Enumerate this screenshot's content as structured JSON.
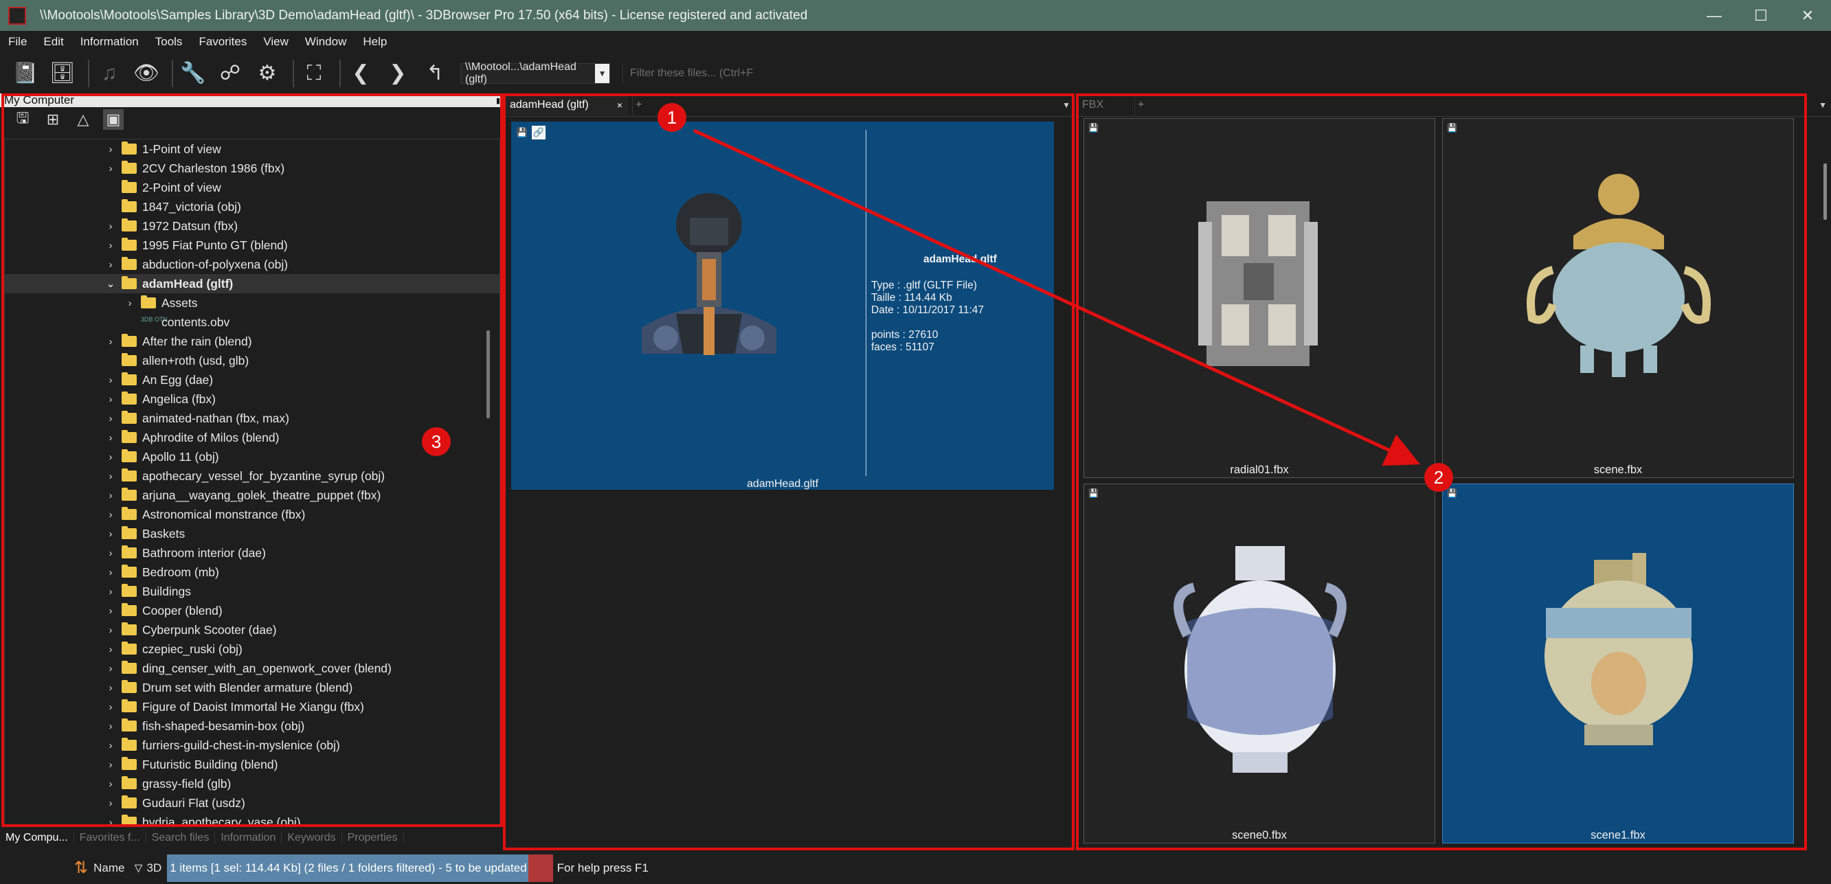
{
  "window": {
    "title": "\\\\Mootools\\Mootools\\Samples Library\\3D Demo\\adamHead (gltf)\\ - 3DBrowser Pro 17.50 (x64 bits) - License registered  and activated",
    "minimize": "—",
    "maximize": "☐",
    "close": "✕"
  },
  "menu": [
    "File",
    "Edit",
    "Information",
    "Tools",
    "Favorites",
    "View",
    "Window",
    "Help"
  ],
  "toolbar": {
    "path": "\\\\Mootool...\\adamHead (gltf)",
    "filter_placeholder": "Filter these files... (Ctrl+F"
  },
  "left_panel": {
    "header": "My Computer",
    "tree": [
      {
        "label": "1-Point of view",
        "chevron": true,
        "type": "folder",
        "indent": 0
      },
      {
        "label": "2CV Charleston 1986 (fbx)",
        "chevron": true,
        "type": "folder",
        "indent": 0
      },
      {
        "label": "2-Point of view",
        "chevron": false,
        "type": "folder",
        "indent": 0
      },
      {
        "label": "1847_victoria (obj)",
        "chevron": false,
        "type": "folder",
        "indent": 0
      },
      {
        "label": "1972 Datsun (fbx)",
        "chevron": true,
        "type": "folder",
        "indent": 0
      },
      {
        "label": "1995 Fiat Punto GT (blend)",
        "chevron": true,
        "type": "folder",
        "indent": 0
      },
      {
        "label": "abduction-of-polyxena (obj)",
        "chevron": true,
        "type": "folder",
        "indent": 0
      },
      {
        "label": "adamHead (gltf)",
        "chevron": "open",
        "type": "folder",
        "indent": 0,
        "selected": true
      },
      {
        "label": "Assets",
        "chevron": true,
        "type": "folder",
        "indent": 1
      },
      {
        "label": "contents.obv",
        "chevron": false,
        "type": "file",
        "indent": 1
      },
      {
        "label": "After the rain (blend)",
        "chevron": true,
        "type": "folder",
        "indent": 0
      },
      {
        "label": "allen+roth (usd, glb)",
        "chevron": false,
        "type": "folder",
        "indent": 0
      },
      {
        "label": "An Egg (dae)",
        "chevron": true,
        "type": "folder",
        "indent": 0
      },
      {
        "label": "Angelica (fbx)",
        "chevron": true,
        "type": "folder",
        "indent": 0
      },
      {
        "label": "animated-nathan (fbx, max)",
        "chevron": true,
        "type": "folder",
        "indent": 0
      },
      {
        "label": "Aphrodite of Milos (blend)",
        "chevron": true,
        "type": "folder",
        "indent": 0
      },
      {
        "label": "Apollo 11 (obj)",
        "chevron": true,
        "type": "folder",
        "indent": 0
      },
      {
        "label": "apothecary_vessel_for_byzantine_syrup (obj)",
        "chevron": true,
        "type": "folder",
        "indent": 0
      },
      {
        "label": "arjuna__wayang_golek_theatre_puppet (fbx)",
        "chevron": true,
        "type": "folder",
        "indent": 0
      },
      {
        "label": "Astronomical monstrance (fbx)",
        "chevron": true,
        "type": "folder",
        "indent": 0
      },
      {
        "label": "Baskets",
        "chevron": true,
        "type": "folder",
        "indent": 0
      },
      {
        "label": "Bathroom interior (dae)",
        "chevron": true,
        "type": "folder",
        "indent": 0
      },
      {
        "label": "Bedroom (mb)",
        "chevron": true,
        "type": "folder",
        "indent": 0
      },
      {
        "label": "Buildings",
        "chevron": true,
        "type": "folder",
        "indent": 0
      },
      {
        "label": "Cooper (blend)",
        "chevron": true,
        "type": "folder",
        "indent": 0
      },
      {
        "label": "Cyberpunk Scooter (dae)",
        "chevron": true,
        "type": "folder",
        "indent": 0
      },
      {
        "label": "czepiec_ruski (obj)",
        "chevron": true,
        "type": "folder",
        "indent": 0
      },
      {
        "label": "ding_censer_with_an_openwork_cover (blend)",
        "chevron": true,
        "type": "folder",
        "indent": 0
      },
      {
        "label": "Drum set with Blender armature (blend)",
        "chevron": true,
        "type": "folder",
        "indent": 0
      },
      {
        "label": "Figure of Daoist Immortal He Xiangu (fbx)",
        "chevron": true,
        "type": "folder",
        "indent": 0
      },
      {
        "label": "fish-shaped-besamin-box (obj)",
        "chevron": true,
        "type": "folder",
        "indent": 0
      },
      {
        "label": "furriers-guild-chest-in-myslenice (obj)",
        "chevron": true,
        "type": "folder",
        "indent": 0
      },
      {
        "label": "Futuristic Building (blend)",
        "chevron": true,
        "type": "folder",
        "indent": 0
      },
      {
        "label": "grassy-field (glb)",
        "chevron": true,
        "type": "folder",
        "indent": 0
      },
      {
        "label": "Gudauri Flat (usdz)",
        "chevron": true,
        "type": "folder",
        "indent": 0
      },
      {
        "label": "hydria_apothecary_vase (obj)",
        "chevron": true,
        "type": "folder",
        "indent": 0
      }
    ],
    "file_icon_text": "3DB OTN",
    "bottom_tabs": [
      "My Compu...",
      "Favorites f...",
      "Search files",
      "Information",
      "Keywords",
      "Properties"
    ]
  },
  "middle_panel": {
    "tab_active": "adamHead (gltf)",
    "tab_close": "×",
    "tab_add": "+",
    "tab_menu": "▼",
    "preview": {
      "filename": "adamHead.gltf",
      "type_line": "Type : .gltf (GLTF File)",
      "size_line": "Taille : 114.44 Kb",
      "date_line": "Date : 10/11/2017 11:47",
      "points_line": "points : 27610",
      "faces_line": "faces : 51107",
      "caption": "adamHead.gltf"
    }
  },
  "right_panel": {
    "tab_active": "FBX",
    "tab_add": "+",
    "tab_menu": "▼",
    "thumbnails": [
      {
        "label": "radial01.fbx",
        "selected": false
      },
      {
        "label": "scene.fbx",
        "selected": false
      },
      {
        "label": "scene0.fbx",
        "selected": false
      },
      {
        "label": "scene1.fbx",
        "selected": true
      }
    ]
  },
  "status_bar": {
    "sort_label": "Name",
    "filter_label": "3D",
    "count_text": "1 items [1 sel: 114.44 Kb] (2 files / 1 folders filtered) - 5 to be updated",
    "help_text": "For help press F1"
  },
  "annotations": {
    "badge1": "1",
    "badge2": "2",
    "badge3": "3",
    "color": "#e01010"
  }
}
